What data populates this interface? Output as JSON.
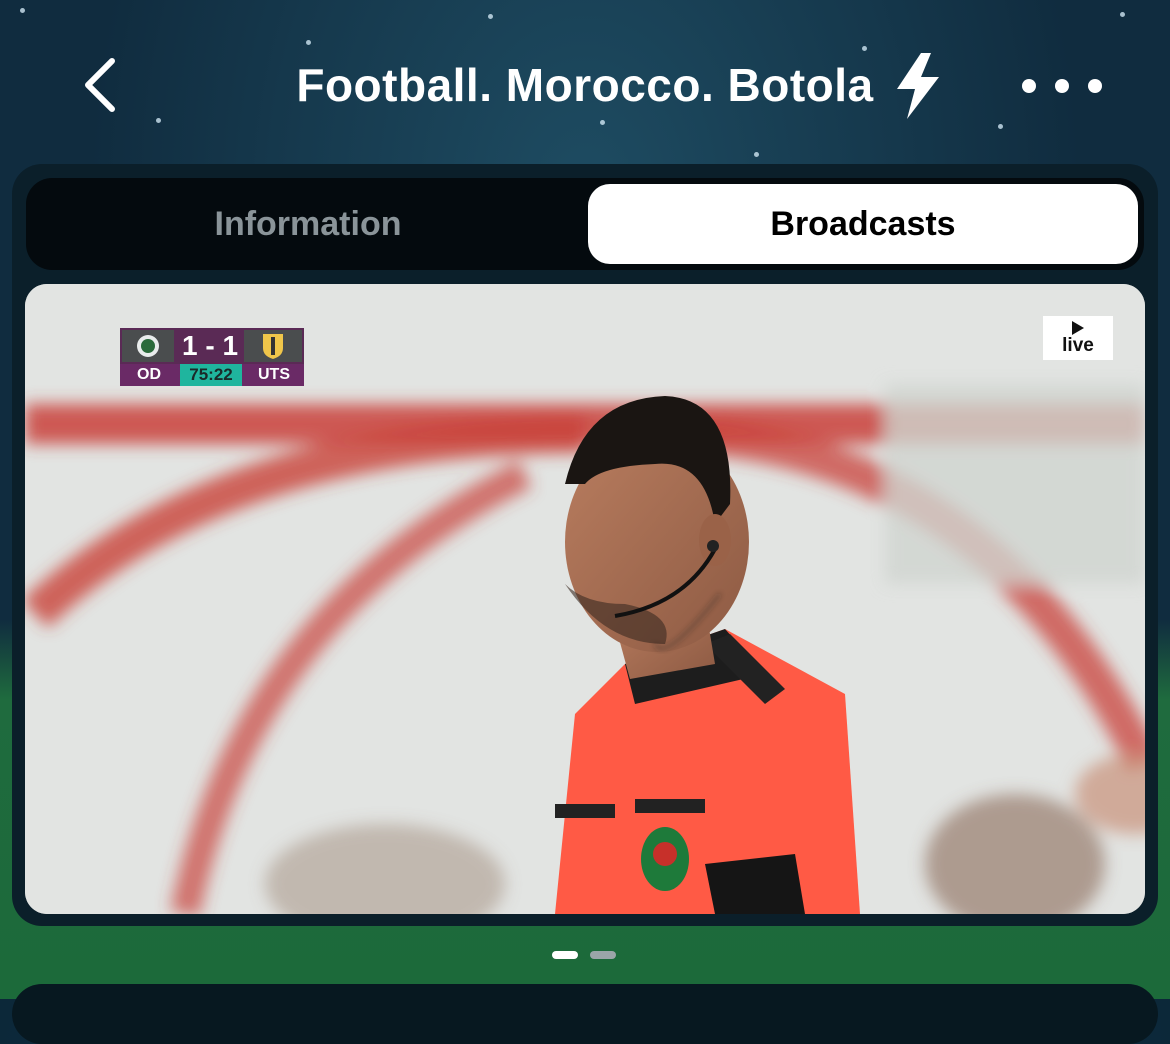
{
  "header": {
    "title": "Football. Morocco. Botola",
    "back_icon": "chevron-left-icon",
    "action_icon": "lightning-bolt-icon",
    "more_icon": "more-horizontal-icon"
  },
  "tabs": [
    {
      "label": "Information",
      "selected": false
    },
    {
      "label": "Broadcasts",
      "selected": true
    }
  ],
  "video": {
    "scoreboard": {
      "home_code": "OD",
      "away_code": "UTS",
      "score": "1 - 1",
      "time": "75:22"
    },
    "live_badge": "live"
  },
  "pagination": {
    "count": 2,
    "active": 1
  },
  "colors": {
    "background": "#0f2f42",
    "tab_active_bg": "#ffffff",
    "tab_inactive_text": "#8a9499",
    "scoreboard_purple": "#6a2a66",
    "scoreboard_time": "#1fb59e"
  }
}
